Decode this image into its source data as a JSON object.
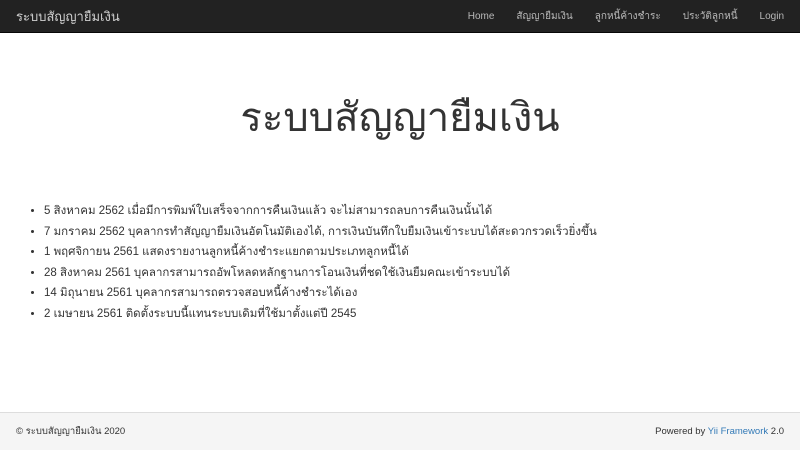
{
  "navbar": {
    "brand": "ระบบสัญญายืมเงิน",
    "items": [
      {
        "label": "Home"
      },
      {
        "label": "สัญญายืมเงิน"
      },
      {
        "label": "ลูกหนี้ค้างชำระ"
      },
      {
        "label": "ประวัติลูกหนี้"
      },
      {
        "label": "Login"
      }
    ]
  },
  "main": {
    "heading": "ระบบสัญญายืมเงิน",
    "news": [
      "5 สิงหาคม 2562 เมื่อมีการพิมพ์ใบเสร็จจากการคืนเงินแล้ว จะไม่สามารถลบการคืนเงินนั้นได้",
      "7 มกราคม 2562 บุคลากรทำสัญญายืมเงินอัตโนมัติเองได้, การเงินบันทึกใบยืมเงินเข้าระบบได้สะดวกรวดเร็วยิ่งขึ้น",
      "1 พฤศจิกายน 2561 แสดงรายงานลูกหนี้ค้างชำระแยกตามประเภทลูกหนี้ได้",
      "28 สิงหาคม 2561 บุคลากรสามารถอัพโหลดหลักฐานการโอนเงินที่ชดใช้เงินยืมคณะเข้าระบบได้",
      "14 มิถุนายน 2561 บุคลากรสามารถตรวจสอบหนี้ค้างชำระได้เอง",
      "2 เมษายน 2561 ติดตั้งระบบนี้แทนระบบเดิมที่ใช้มาตั้งแต่ปี 2545"
    ]
  },
  "footer": {
    "copyright": "© ระบบสัญญายืมเงิน 2020",
    "powered_prefix": "Powered by ",
    "framework_link": "Yii Framework",
    "version": " 2.0"
  },
  "colors": {
    "navbar_bg": "#222222",
    "footer_bg": "#f5f5f5",
    "link": "#337ab7"
  }
}
